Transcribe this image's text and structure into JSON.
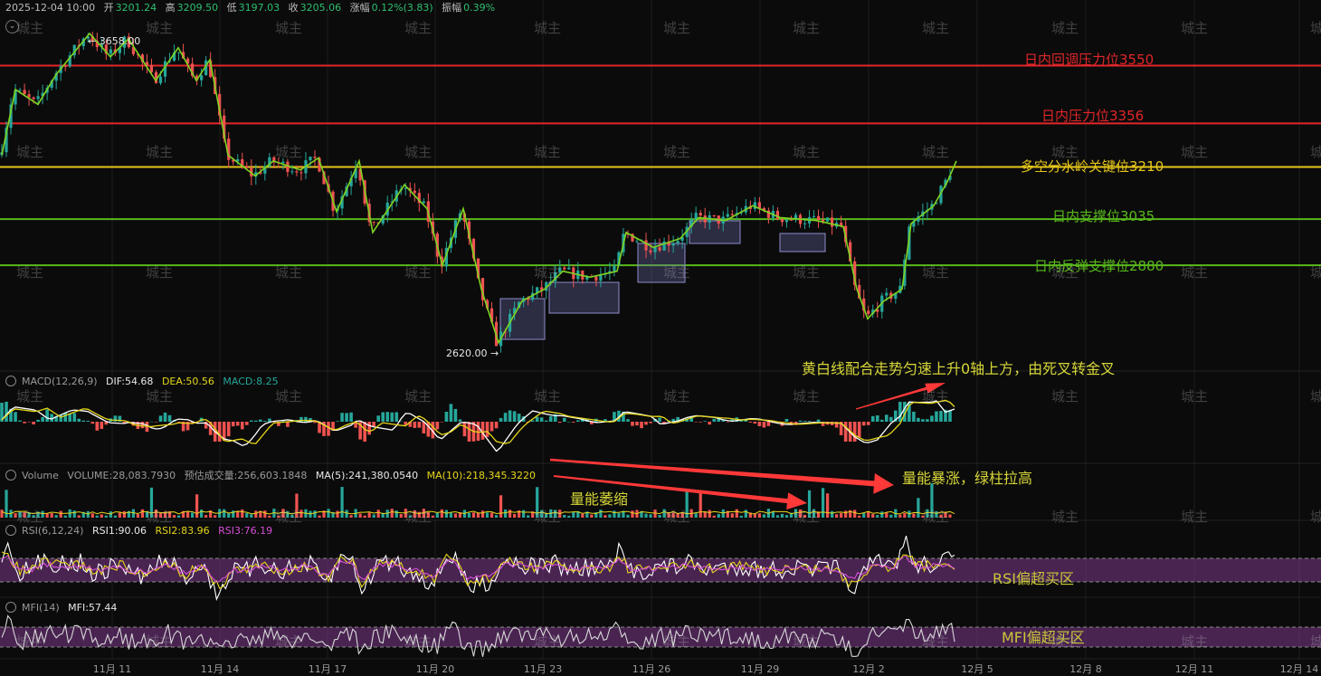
{
  "header": {
    "datetime": "2025-12-04 10:00",
    "open_label": "开",
    "open": "3201.24",
    "high_label": "高",
    "high": "3209.50",
    "low_label": "低",
    "low": "3197.03",
    "close_label": "收",
    "close": "3205.06",
    "change_label": "涨幅",
    "change": "0.12%(3.83)",
    "amplitude_label": "振幅",
    "amplitude": "0.39%"
  },
  "extremes": {
    "high": "← 3658.00",
    "low": "2620.00 →"
  },
  "levels": [
    {
      "label": "日内回调压力位3550",
      "value": 3550,
      "color": "#e0262a"
    },
    {
      "label": "日内压力位3356",
      "value": 3356,
      "color": "#e0262a"
    },
    {
      "label": "多空分水岭关键位3210",
      "value": 3210,
      "color": "#e6c619"
    },
    {
      "label": "日内支撑位3035",
      "value": 3035,
      "color": "#58b81c"
    },
    {
      "label": "日内反弹支撑位2880",
      "value": 2880,
      "color": "#58b81c"
    }
  ],
  "macd_header": {
    "name": "MACD(12,26,9)",
    "dif": "DIF:54.68",
    "dea": "DEA:50.56",
    "macd": "MACD:8.25"
  },
  "volume_header": {
    "name": "Volume",
    "volume": "VOLUME:28,083.7930",
    "est": "预估成交量:256,603.1848",
    "ma5": "MA(5):241,380.0540",
    "ma10": "MA(10):218,345.3220"
  },
  "rsi_header": {
    "name": "RSI(6,12,24)",
    "rsi1": "RSI1:90.06",
    "rsi2": "RSI2:83.96",
    "rsi3": "RSI3:76.19"
  },
  "mfi_header": {
    "name": "MFI(14)",
    "mfi": "MFI:57.44"
  },
  "annotations": {
    "macd_note": "黄白线配合走势匀速上升0轴上方，由死叉转金叉",
    "volume_shrink": "量能萎缩",
    "volume_surge": "量能暴涨，绿柱拉高",
    "rsi_note": "RSI偏超买区",
    "mfi_note": "MFI偏超买区"
  },
  "watermark": "城主",
  "colors": {
    "up": "#26a69a",
    "down": "#ef5350",
    "dif": "#ffffff",
    "dea": "#e6d619",
    "band": "#7d3a8c",
    "arrow": "#ff3838"
  },
  "chart_data": {
    "type": "candlestick",
    "x_ticks": [
      "11月 11",
      "11月 14",
      "11月 17",
      "11月 20",
      "11月 23",
      "11月 26",
      "11月 29",
      "12月 2",
      "12月 5",
      "12月 8",
      "12月 11",
      "12月 14"
    ],
    "key_points": [
      {
        "label": "start",
        "price": 3250
      },
      {
        "label": "peak",
        "price": 3658
      },
      {
        "label": "drop",
        "price": 3250
      },
      {
        "label": "low",
        "price": 2620
      },
      {
        "label": "range",
        "price": 3030
      },
      {
        "label": "dip",
        "price": 2700
      },
      {
        "label": "now",
        "price": 3205.06
      }
    ],
    "ylim": [
      2540,
      3740
    ],
    "rsi_overbought_band": [
      70,
      80
    ],
    "mfi_overbought_band": [
      70,
      80
    ]
  }
}
